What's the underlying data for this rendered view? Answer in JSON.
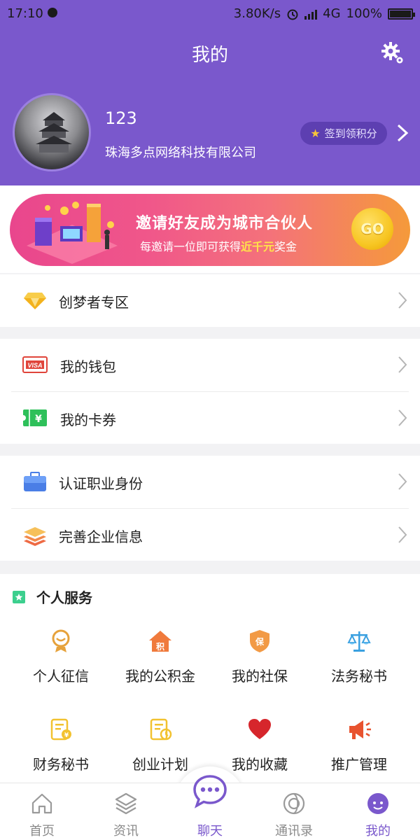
{
  "status_bar": {
    "time": "17:10",
    "net_speed": "3.80K/s",
    "network": "4G",
    "battery": "100%"
  },
  "header": {
    "title": "我的",
    "settings_icon": "gear-icon"
  },
  "profile": {
    "username": "123",
    "company": "珠海多点网络科技有限公司",
    "checkin_label": "签到领积分"
  },
  "banner": {
    "title": "邀请好友成为城市合伙人",
    "subtitle_pre": "每邀请一位即可获得",
    "subtitle_highlight": "近千元",
    "subtitle_post": "奖金",
    "go_label": "GO"
  },
  "menu": {
    "dreamers": "创梦者专区",
    "wallet": "我的钱包",
    "coupons": "我的卡券",
    "verify_job": "认证职业身份",
    "company_info": "完善企业信息"
  },
  "services": {
    "title": "个人服务",
    "items": [
      {
        "label": "个人征信",
        "icon": "credit-report-icon"
      },
      {
        "label": "我的公积金",
        "icon": "housing-fund-icon"
      },
      {
        "label": "我的社保",
        "icon": "social-security-icon"
      },
      {
        "label": "法务秘书",
        "icon": "legal-scale-icon"
      },
      {
        "label": "财务秘书",
        "icon": "finance-doc-icon"
      },
      {
        "label": "创业计划",
        "icon": "business-plan-icon"
      },
      {
        "label": "我的收藏",
        "icon": "heart-icon"
      },
      {
        "label": "推广管理",
        "icon": "megaphone-icon"
      }
    ]
  },
  "tabbar": {
    "items": [
      {
        "label": "首页",
        "icon": "home-icon"
      },
      {
        "label": "资讯",
        "icon": "layers-icon"
      },
      {
        "label": "聊天",
        "icon": "chat-bubble-icon"
      },
      {
        "label": "通讯录",
        "icon": "contacts-icon"
      },
      {
        "label": "我的",
        "icon": "profile-face-icon"
      }
    ],
    "active": "我的"
  },
  "colors": {
    "brand": "#7a58cc",
    "brand_dark": "#5d3fb1",
    "banner_start": "#e9468d",
    "banner_end": "#f59a3a"
  }
}
